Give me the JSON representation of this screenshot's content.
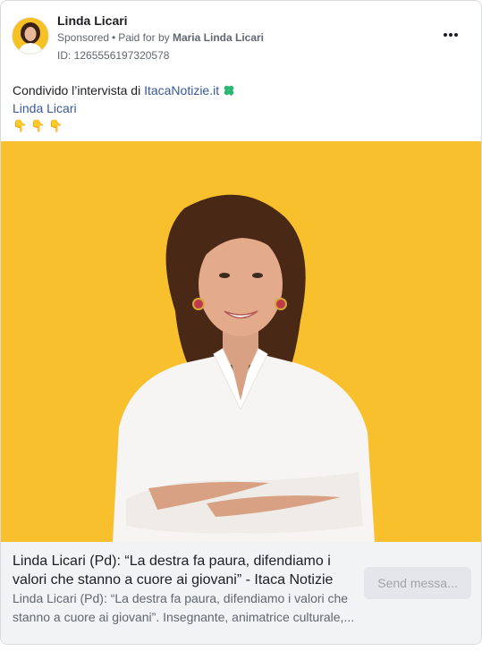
{
  "post": {
    "page_name": "Linda Licari",
    "sponsored": "Sponsored",
    "dot": "•",
    "paid_for_prefix": "Paid for by",
    "paid_for_name": "Maria Linda Licari",
    "ad_id": "ID: 1265556197320578",
    "more_icon": "three-dots-icon"
  },
  "message": {
    "line1_text": "Condivido l’intervista di ",
    "line1_link": "ItacaNotizie.it",
    "line1_icon": "four-leaf-clover-icon",
    "line2_link": "Linda Licari",
    "line3_emoji": "👇👇👇"
  },
  "link_preview": {
    "headline": "Linda Licari (Pd): “La destra fa paura, difendiamo i valori che stanno a cuore ai giovani” - Itaca Notizie",
    "description": "Linda Licari (Pd): “La destra fa paura, difendiamo i valori che stanno a cuore ai giovani”. Insegnante, animatrice culturale,...",
    "cta_label": "Send messa..."
  },
  "colors": {
    "photo_background": "#f7c02c",
    "link": "#385898",
    "clover": "#2bb673"
  }
}
